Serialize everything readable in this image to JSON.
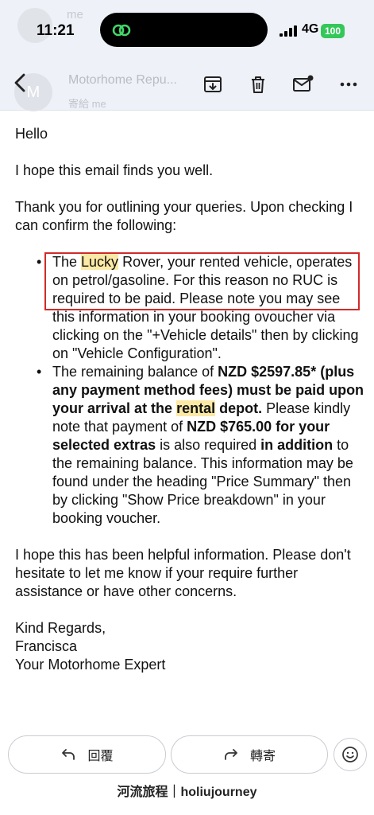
{
  "status_bar": {
    "time": "11:21",
    "network": "4G",
    "battery": "100"
  },
  "ghost_header": {
    "sender": "me",
    "subject": ""
  },
  "toolbar": {
    "sender_blurred": "Motorhome Repu...",
    "to_blurred": "寄給 me",
    "avatar_letter": "M"
  },
  "email": {
    "greeting": "Hello",
    "p1": "I hope this email finds you well.",
    "p2": "Thank you for outlining your queries. Upon checking I can confirm the following:",
    "bullet1": {
      "a": "The ",
      "hl": "Lucky",
      "b": " Rover, your rented vehicle, operates on petrol/gasoline. For this reason no RUC is required to be paid. Please note you may see this information in your booking ovoucher via clicking on the \"+Vehicle details\" then by clicking on \"Vehicle Configuration\"."
    },
    "bullet2": {
      "a": "The remaining balance of ",
      "b_bold": "NZD $2597.85* (plus any payment method fees) must be paid upon your arrival at the ",
      "hl": "rental",
      "c_bold": " depot.",
      "d": " Please kindly note that payment of ",
      "e_bold": "NZD $765.00 for your selected extras",
      "f": " is also required ",
      "g_bold": "in addition",
      "h": " to the remaining balance. This information may be found under the heading \"Price Summary\" then by clicking \"Show Price breakdown\" in your booking voucher."
    },
    "p3": "I hope this has been helpful information. Please don't hesitate to let me know if your require further assistance or have other concerns.",
    "signoff1": "Kind Regards,",
    "signoff2": "Francisca",
    "signoff3": "Your Motorhome Expert"
  },
  "actions": {
    "reply": "回覆",
    "forward": "轉寄"
  },
  "footer": "河流旅程｜holiujourney",
  "colors": {
    "highlight": "#fbe9a6",
    "annotation_box": "#d22a2a",
    "toolbar_bg": "#eef1f7"
  },
  "icons": [
    "back-arrow-icon",
    "archive-icon",
    "trash-icon",
    "mark-unread-icon",
    "more-icon",
    "reply-icon",
    "forward-icon",
    "emoji-icon"
  ]
}
